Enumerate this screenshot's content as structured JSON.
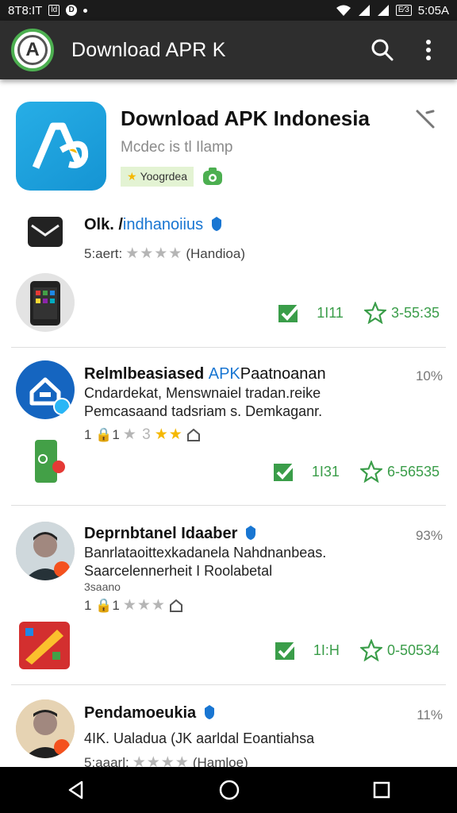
{
  "status_bar": {
    "left_text": "8T8:IT",
    "left_box": "ld",
    "left_circle": "D",
    "time": "5:05A",
    "signal_box": "E⁄3"
  },
  "toolbar": {
    "title": "Download APR K",
    "search_icon": "search-icon",
    "menu_icon": "more-vert-icon"
  },
  "app": {
    "title": "Download APK Indonesia",
    "subtitle": "Mcdec is tl Ilamp",
    "badge": "Yoogrdea",
    "accent": "#1594d3"
  },
  "rows": [
    {
      "title": "Olk. /",
      "title_blue": "indhanoiius",
      "meta_prefix": "5:aert:",
      "stars": "★★★★",
      "meta_suffix": "(Handioa)",
      "count": "1I11",
      "rating": "3-55:35"
    },
    {
      "title": "Relmlbeasiased ",
      "title_blue": "APK",
      "title_rest": "Paatnoanan",
      "desc1": "Cndardekat, Menswnaiel tradan.reike",
      "desc2": "Pemcasaand tadsriam s. Demkaganr.",
      "meta": "1 🔒1",
      "stars_pre": "★ 3",
      "stars": "★★",
      "pct": "10%",
      "count": "1I31",
      "rating": "6-56535"
    },
    {
      "title": "Deprnbtanel Idaaber",
      "desc1": "Banrlataoittexkadanela Nahdnanbeas.",
      "desc2": "Saarcelennerheit I Roolabetal",
      "desc3": "3saano",
      "meta": "1 🔒1",
      "stars": "★★★",
      "pct": "93%",
      "count": "1I:H",
      "rating": "0-50534"
    },
    {
      "title": "Pendamoeukia",
      "desc1": "4IK. Ualadua (JK aarldal Eoantiahsa",
      "meta_prefix": "5:aaarl:",
      "stars": "★★★★",
      "meta_suffix": "(Hamloe)",
      "pct": "11%"
    }
  ],
  "colors": {
    "toolbar": "#2e2e2e",
    "status_bar": "#1b1b1b",
    "action_green": "#3a9d49",
    "verified_blue": "#1976d2"
  }
}
